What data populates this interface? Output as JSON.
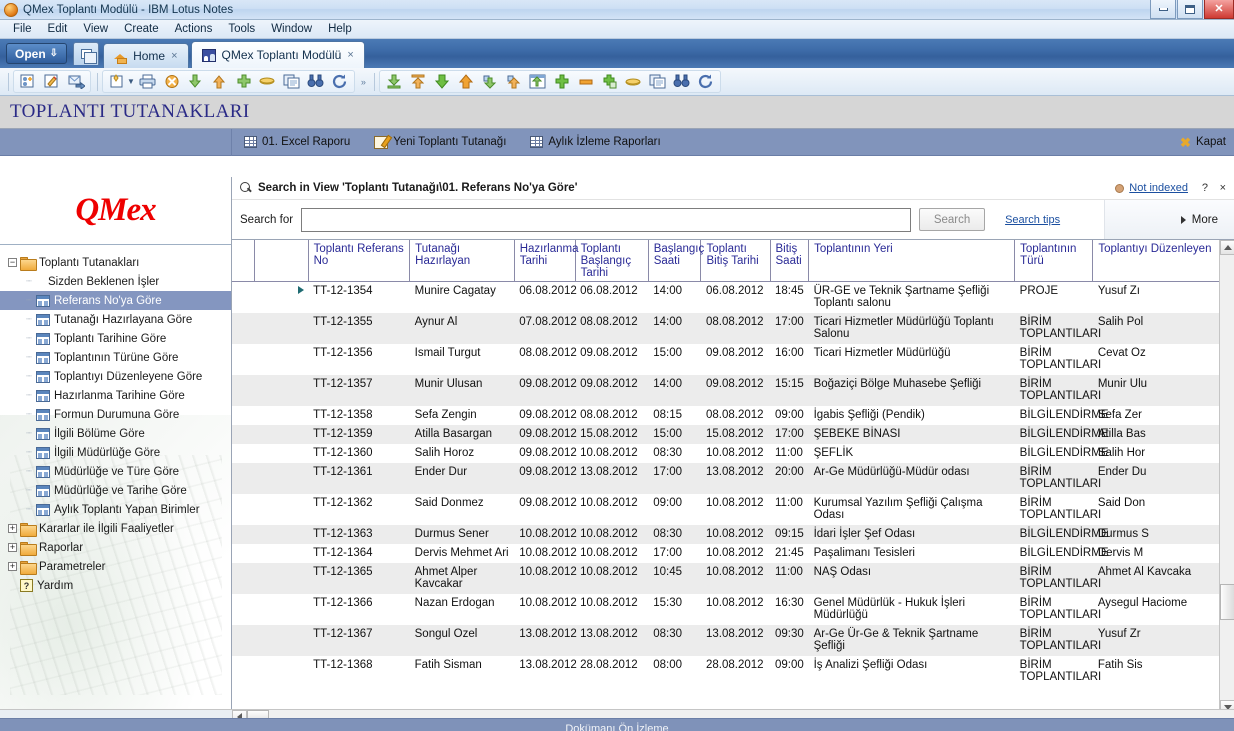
{
  "window": {
    "title": "QMex Toplantı Modülü - IBM Lotus Notes",
    "app_icon": "lotus-notes-icon",
    "minimize_label": "Minimize",
    "maximize_label": "Maximize",
    "close_label": "Close"
  },
  "menubar": {
    "items": [
      {
        "label": "File"
      },
      {
        "label": "Edit"
      },
      {
        "label": "View"
      },
      {
        "label": "Create"
      },
      {
        "label": "Actions"
      },
      {
        "label": "Tools"
      },
      {
        "label": "Window"
      },
      {
        "label": "Help"
      }
    ]
  },
  "tabstrip": {
    "open_button": "Open",
    "tabs": [
      {
        "label": "Home",
        "icon": "home-icon",
        "active": false,
        "close": "×"
      },
      {
        "label": "QMex Toplantı Modülü",
        "icon": "qmex-icon",
        "active": true,
        "close": "×"
      }
    ]
  },
  "toolbar": {
    "groups": [
      {
        "name": "group-contacts",
        "icons": [
          "new-contact-icon",
          "edit-document-icon",
          "forward-message-icon"
        ]
      },
      {
        "name": "group-document",
        "icons": [
          "new-document-icon",
          "dropdown-arrow",
          "print-icon",
          "deny-access-icon",
          "move-down-icon",
          "move-up-icon",
          "add-item-icon",
          "bookmark-icon",
          "copy-icon",
          "find-icon",
          "refresh-icon"
        ]
      },
      {
        "name": "group-chevron",
        "icons": [
          "more-chevron-icon"
        ]
      },
      {
        "name": "group-transfer",
        "icons": [
          "download-icon",
          "upload-top-icon",
          "down-arrow-icon",
          "up-arrow-icon",
          "sync-down-icon",
          "sync-up-icon",
          "export-window-icon",
          "plus-icon",
          "minus-icon",
          "add-copy-icon",
          "layers-icon",
          "copy-window-icon",
          "binoculars-icon",
          "reload-icon"
        ]
      }
    ]
  },
  "banner": {
    "title": "TOPLANTI TUTANAKLARI"
  },
  "actionbar": {
    "items": [
      {
        "label": "01. Excel Raporu",
        "icon": "grid-icon"
      },
      {
        "label": "Yeni Toplantı Tutanağı",
        "icon": "pencil-icon"
      },
      {
        "label": "Aylık İzleme Raporları",
        "icon": "grid-icon"
      }
    ],
    "close": {
      "label": "Kapat",
      "icon": "close-x-icon"
    }
  },
  "search": {
    "title": "Search in View 'Toplantı Tutanağı\\01. Referans No'ya Göre'",
    "icon": "magnifier-icon",
    "index_status": "Not indexed",
    "index_status_color": "#d4a276",
    "help_glyph": "?",
    "close_glyph": "×",
    "label": "Search for",
    "value": "",
    "placeholder": "",
    "search_button": "Search",
    "tips_link": "Search tips",
    "more_label": "More"
  },
  "sidebar": {
    "logo": "QMex",
    "items": [
      {
        "label": "Toplantı Tutanakları",
        "icon": "folder-icon",
        "twisty": "−",
        "level": 0,
        "selected": false
      },
      {
        "label": "Sizden Beklenen İşler",
        "icon": "none",
        "twisty": "",
        "level": 1,
        "selected": false
      },
      {
        "label": "Referans No'ya Göre",
        "icon": "view-icon",
        "twisty": "",
        "level": 1,
        "selected": true
      },
      {
        "label": "Tutanağı Hazırlayana Göre",
        "icon": "view-icon",
        "twisty": "",
        "level": 1,
        "selected": false
      },
      {
        "label": "Toplantı Tarihine Göre",
        "icon": "view-icon",
        "twisty": "",
        "level": 1,
        "selected": false
      },
      {
        "label": "Toplantının Türüne Göre",
        "icon": "view-icon",
        "twisty": "",
        "level": 1,
        "selected": false
      },
      {
        "label": "Toplantıyı Düzenleyene Göre",
        "icon": "view-icon",
        "twisty": "",
        "level": 1,
        "selected": false
      },
      {
        "label": "Hazırlanma Tarihine Göre",
        "icon": "view-icon",
        "twisty": "",
        "level": 1,
        "selected": false
      },
      {
        "label": "Formun Durumuna Göre",
        "icon": "view-icon",
        "twisty": "",
        "level": 1,
        "selected": false
      },
      {
        "label": "İlgili Bölüme Göre",
        "icon": "view-icon",
        "twisty": "",
        "level": 1,
        "selected": false
      },
      {
        "label": "İlgili Müdürlüğe Göre",
        "icon": "view-icon",
        "twisty": "",
        "level": 1,
        "selected": false
      },
      {
        "label": "Müdürlüğe ve Türe Göre",
        "icon": "view-icon",
        "twisty": "",
        "level": 1,
        "selected": false
      },
      {
        "label": "Müdürlüğe ve Tarihe Göre",
        "icon": "view-icon",
        "twisty": "",
        "level": 1,
        "selected": false
      },
      {
        "label": "Aylık Toplantı Yapan Birimler",
        "icon": "view-icon",
        "twisty": "",
        "level": 1,
        "selected": false
      },
      {
        "label": "Kararlar ile İlgili Faaliyetler",
        "icon": "folder-icon",
        "twisty": "+",
        "level": 0,
        "selected": false
      },
      {
        "label": "Raporlar",
        "icon": "folder-icon",
        "twisty": "+",
        "level": 0,
        "selected": false
      },
      {
        "label": "Parametreler",
        "icon": "folder-icon",
        "twisty": "+",
        "level": 0,
        "selected": false
      },
      {
        "label": "Yardım",
        "icon": "help-icon",
        "twisty": "",
        "level": 0,
        "selected": false
      }
    ]
  },
  "table": {
    "columns": [
      "Toplantı Referans No",
      "Tutanağı Hazırlayan",
      "Hazırlanma Tarihi",
      "Toplantı Başlangıç Tarihi",
      "Başlangıç Saati",
      "Toplantı Bitiş Tarihi",
      "Bitiş Saati",
      "Toplantının Yeri",
      "Toplantının Türü",
      "Toplantıyı Düzenleyen"
    ],
    "rows": [
      {
        "ref": "TT-12-1354",
        "prep": "Munire Cagatay",
        "hazirlanma": "06.08.2012",
        "baslangic_tarih": "06.08.2012",
        "baslangic_saat": "14:00",
        "bitis_tarih": "06.08.2012",
        "bitis_saat": "18:45",
        "yer": "ÜR-GE ve Teknik Şartname Şefliği Toplantı salonu",
        "tur": "PROJE",
        "duzenleyen": "Yusuf Zı",
        "twisty": true
      },
      {
        "ref": "TT-12-1355",
        "prep": "Aynur Al",
        "hazirlanma": "07.08.2012",
        "baslangic_tarih": "08.08.2012",
        "baslangic_saat": "14:00",
        "bitis_tarih": "08.08.2012",
        "bitis_saat": "17:00",
        "yer": "Ticari Hizmetler Müdürlüğü Toplantı Salonu",
        "tur": "BİRİM TOPLANTILARI",
        "duzenleyen": "Salih Pol",
        "twisty": false
      },
      {
        "ref": "TT-12-1356",
        "prep": "Ismail Turgut",
        "hazirlanma": "08.08.2012",
        "baslangic_tarih": "09.08.2012",
        "baslangic_saat": "15:00",
        "bitis_tarih": "09.08.2012",
        "bitis_saat": "16:00",
        "yer": "Ticari Hizmetler Müdürlüğü",
        "tur": "BİRİM TOPLANTILARI",
        "duzenleyen": "Cevat Oz",
        "twisty": false
      },
      {
        "ref": "TT-12-1357",
        "prep": "Munir Ulusan",
        "hazirlanma": "09.08.2012",
        "baslangic_tarih": "09.08.2012",
        "baslangic_saat": "14:00",
        "bitis_tarih": "09.08.2012",
        "bitis_saat": "15:15",
        "yer": "Boğaziçi Bölge Muhasebe Şefliği",
        "tur": "BİRİM TOPLANTILARI",
        "duzenleyen": "Munir Ulu",
        "twisty": false
      },
      {
        "ref": "TT-12-1358",
        "prep": "Sefa Zengin",
        "hazirlanma": "09.08.2012",
        "baslangic_tarih": "08.08.2012",
        "baslangic_saat": "08:15",
        "bitis_tarih": "08.08.2012",
        "bitis_saat": "09:00",
        "yer": "İgabis Şefliği (Pendik)",
        "tur": "BİLGİLENDİRME",
        "duzenleyen": "Sefa Zer",
        "twisty": false
      },
      {
        "ref": "TT-12-1359",
        "prep": "Atilla Basargan",
        "hazirlanma": "09.08.2012",
        "baslangic_tarih": "15.08.2012",
        "baslangic_saat": "15:00",
        "bitis_tarih": "15.08.2012",
        "bitis_saat": "17:00",
        "yer": "ŞEBEKE BİNASI",
        "tur": "BİLGİLENDİRME",
        "duzenleyen": "Atilla Bas",
        "twisty": false
      },
      {
        "ref": "TT-12-1360",
        "prep": "Salih Horoz",
        "hazirlanma": "09.08.2012",
        "baslangic_tarih": "10.08.2012",
        "baslangic_saat": "08:30",
        "bitis_tarih": "10.08.2012",
        "bitis_saat": "11:00",
        "yer": "ŞEFLİK",
        "tur": "BİLGİLENDİRME",
        "duzenleyen": "Salih Hor",
        "twisty": false
      },
      {
        "ref": "TT-12-1361",
        "prep": "Ender Dur",
        "hazirlanma": "09.08.2012",
        "baslangic_tarih": "13.08.2012",
        "baslangic_saat": "17:00",
        "bitis_tarih": "13.08.2012",
        "bitis_saat": "20:00",
        "yer": "Ar-Ge Müdürlüğü-Müdür odası",
        "tur": "BİRİM TOPLANTILARI",
        "duzenleyen": "Ender Du",
        "twisty": false
      },
      {
        "ref": "TT-12-1362",
        "prep": "Said Donmez",
        "hazirlanma": "09.08.2012",
        "baslangic_tarih": "10.08.2012",
        "baslangic_saat": "09:00",
        "bitis_tarih": "10.08.2012",
        "bitis_saat": "11:00",
        "yer": "Kurumsal Yazılım Şefliği Çalışma Odası",
        "tur": "BİRİM TOPLANTILARI",
        "duzenleyen": "Said Don",
        "twisty": false
      },
      {
        "ref": "TT-12-1363",
        "prep": "Durmus Sener",
        "hazirlanma": "10.08.2012",
        "baslangic_tarih": "10.08.2012",
        "baslangic_saat": "08:30",
        "bitis_tarih": "10.08.2012",
        "bitis_saat": "09:15",
        "yer": "İdari İşler Şef Odası",
        "tur": "BİLGİLENDİRME",
        "duzenleyen": "Durmus S",
        "twisty": false
      },
      {
        "ref": "TT-12-1364",
        "prep": "Dervis Mehmet Ari",
        "hazirlanma": "10.08.2012",
        "baslangic_tarih": "10.08.2012",
        "baslangic_saat": "17:00",
        "bitis_tarih": "10.08.2012",
        "bitis_saat": "21:45",
        "yer": "Paşalimanı Tesisleri",
        "tur": "BİLGİLENDİRME",
        "duzenleyen": "Dervis M",
        "twisty": false
      },
      {
        "ref": "TT-12-1365",
        "prep": "Ahmet Alper Kavcakar",
        "hazirlanma": "10.08.2012",
        "baslangic_tarih": "10.08.2012",
        "baslangic_saat": "10:45",
        "bitis_tarih": "10.08.2012",
        "bitis_saat": "11:00",
        "yer": "NAŞ Odası",
        "tur": "BİRİM TOPLANTILARI",
        "duzenleyen": "Ahmet Al Kavcaka",
        "twisty": false
      },
      {
        "ref": "TT-12-1366",
        "prep": "Nazan Erdogan",
        "hazirlanma": "10.08.2012",
        "baslangic_tarih": "10.08.2012",
        "baslangic_saat": "15:30",
        "bitis_tarih": "10.08.2012",
        "bitis_saat": "16:30",
        "yer": "Genel Müdürlük - Hukuk İşleri Müdürlüğü",
        "tur": "BİRİM TOPLANTILARI",
        "duzenleyen": "Aysegul Haciome",
        "twisty": false
      },
      {
        "ref": "TT-12-1367",
        "prep": "Songul Ozel",
        "hazirlanma": "13.08.2012",
        "baslangic_tarih": "13.08.2012",
        "baslangic_saat": "08:30",
        "bitis_tarih": "13.08.2012",
        "bitis_saat": "09:30",
        "yer": "Ar-Ge Ür-Ge & Teknik Şartname Şefliği",
        "tur": "BİRİM TOPLANTILARI",
        "duzenleyen": "Yusuf Zr",
        "twisty": false
      },
      {
        "ref": "TT-12-1368",
        "prep": "Fatih Sisman",
        "hazirlanma": "13.08.2012",
        "baslangic_tarih": "28.08.2012",
        "baslangic_saat": "08:00",
        "bitis_tarih": "28.08.2012",
        "bitis_saat": "09:00",
        "yer": "İş Analizi Şefliği Odası",
        "tur": "BİRİM TOPLANTILARI",
        "duzenleyen": "Fatih Sis",
        "twisty": false
      }
    ]
  },
  "statusbar": {
    "text": "Dokümanı Ön İzleme"
  }
}
